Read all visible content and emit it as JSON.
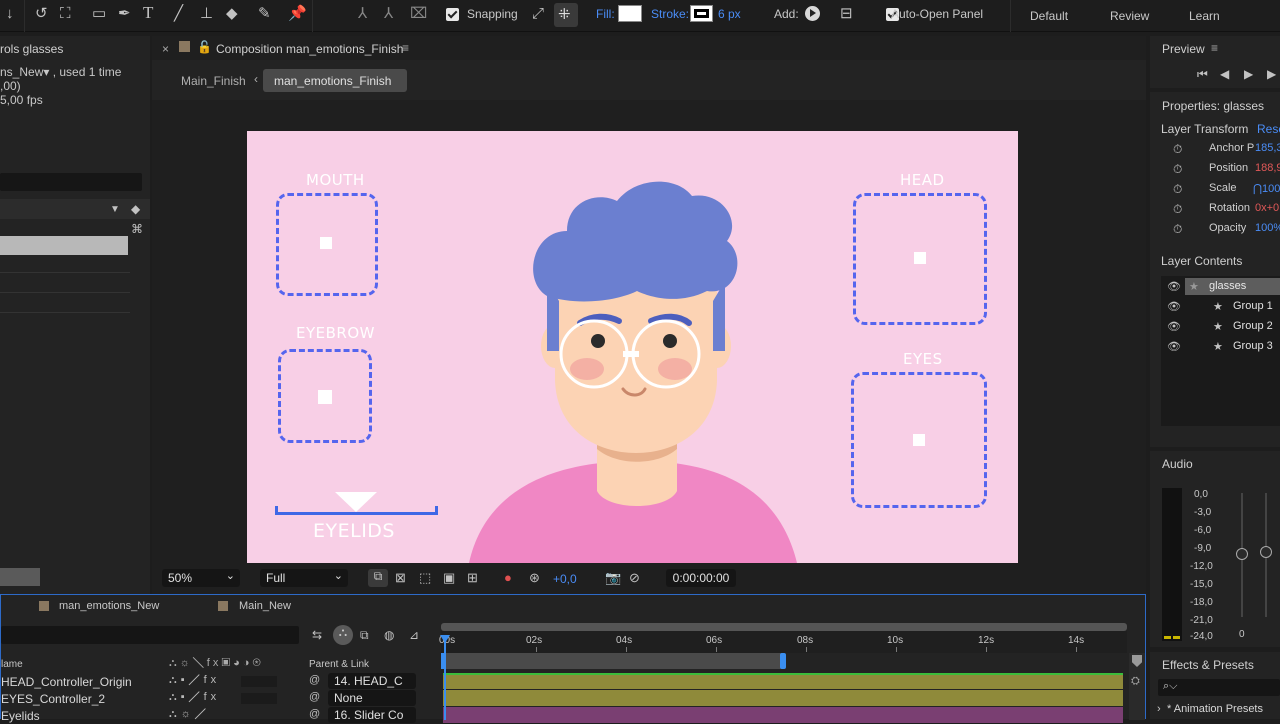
{
  "toolbar": {
    "snapping_label": "Snapping",
    "fill_label": "Fill:",
    "stroke_label": "Stroke:",
    "stroke_value": "6 px",
    "add_label": "Add:",
    "auto_open_label": "Auto-Open Panel",
    "workspaces": [
      "Default",
      "Review",
      "Learn"
    ]
  },
  "project": {
    "title": "rols glasses",
    "info_line1": "ns_New▾ , used 1 time",
    "info_line2": ",00)",
    "info_line3": "5,00 fps"
  },
  "comp_tab": {
    "title": "Composition man_emotions_Finish",
    "breadcrumb_parent": "Main_Finish",
    "breadcrumb_current": "man_emotions_Finish"
  },
  "canvas": {
    "labels": {
      "mouth": "MOUTH",
      "eyebrow": "EYEBROW",
      "eyelids": "EYELIDS",
      "head": "HEAD",
      "eyes": "EYES"
    }
  },
  "viewer_bar": {
    "zoom": "50%",
    "resolution": "Full",
    "exposure": "+0,0",
    "timecode": "0:00:00:00"
  },
  "preview": {
    "title": "Preview"
  },
  "properties": {
    "title": "Properties: glasses",
    "section": "Layer Transform",
    "reset": "Rese",
    "rows": [
      {
        "label": "Anchor P",
        "value": "185,3"
      },
      {
        "label": "Position",
        "value": "188,9"
      },
      {
        "label": "Scale",
        "value": "⋂100%"
      },
      {
        "label": "Rotation",
        "value": "0x+0"
      },
      {
        "label": "Opacity",
        "value": "100%"
      }
    ]
  },
  "layer_contents": {
    "title": "Layer Contents",
    "items": [
      "glasses",
      "Group 1",
      "Group 2",
      "Group 3"
    ]
  },
  "audio": {
    "title": "Audio",
    "scale": [
      "0,0",
      "-3,0",
      "-6,0",
      "-9,0",
      "-12,0",
      "-15,0",
      "-18,0",
      "-21,0",
      "-24,0"
    ],
    "slider_zero": "0"
  },
  "effects": {
    "title": "Effects & Presets",
    "search_icon_text": "⌕⌵",
    "animation_presets": "* Animation Presets"
  },
  "timeline": {
    "tabs": [
      "man_emotions_New",
      "Main_New"
    ],
    "col_name": "lame",
    "col_parent": "Parent & Link",
    "ruler": [
      "00s",
      "02s",
      "04s",
      "06s",
      "08s",
      "10s",
      "12s",
      "14s"
    ],
    "layers": [
      {
        "name": "HEAD_Controller_Origin",
        "parent": "14. HEAD_C"
      },
      {
        "name": "EYES_Controller_2",
        "parent": "None"
      },
      {
        "name": "Eyelids",
        "parent": "16. Slider Co"
      }
    ]
  },
  "colors": {
    "accent": "#4a8cf5",
    "canvas_bg": "#f8cfe6",
    "controller": "#5565ee",
    "hair": "#6b7fd0",
    "shirt": "#f087c4",
    "skin": "#fcd3b4",
    "track_olive": "#8f8a3a"
  }
}
